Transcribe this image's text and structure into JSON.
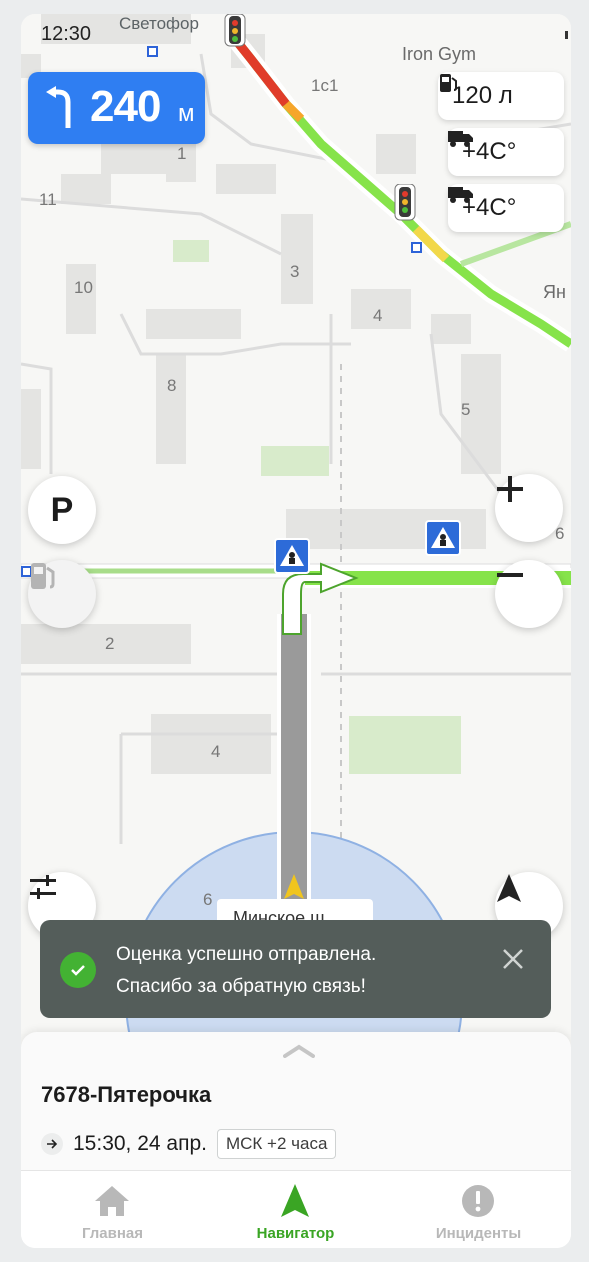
{
  "status_bar": {
    "time": "12:30"
  },
  "map": {
    "labels": {
      "svetofor": "Светофор",
      "iron_gym": "Iron Gym",
      "b_1s1": "1с1",
      "b_1": "1",
      "b_11": "11",
      "b_10": "10",
      "b_3": "3",
      "b_4a": "4",
      "b_8": "8",
      "b_5": "5",
      "b_yan": "Ян",
      "b_6a": "6",
      "b_2": "2",
      "b_4b": "4",
      "b_6b": "6",
      "street": "Минское ш"
    }
  },
  "maneuver": {
    "distance": "240",
    "unit": "м"
  },
  "info_pills": {
    "fuel": "120 л",
    "temp1": "+4C°",
    "temp2": "+4C°"
  },
  "buttons": {
    "parking_label": "P"
  },
  "toast": {
    "line1": "Оценка успешно отправлена.",
    "line2": "Спасибо за обратную связь!"
  },
  "sheet": {
    "destination": "7678-Пятерочка",
    "eta": "15:30, 24 апр.",
    "timezone": "МСК +2 часа"
  },
  "tabs": [
    {
      "label": "Главная",
      "icon": "home-icon",
      "active": false
    },
    {
      "label": "Навигатор",
      "icon": "navigator-icon",
      "active": true
    },
    {
      "label": "Инциденты",
      "icon": "alert-icon",
      "active": false
    }
  ],
  "colors": {
    "route": "#86e34a",
    "maneuver_card": "#2f7ef2",
    "toast_bg": "#545d5a",
    "success": "#43b233",
    "active_tab": "#3aa524"
  }
}
